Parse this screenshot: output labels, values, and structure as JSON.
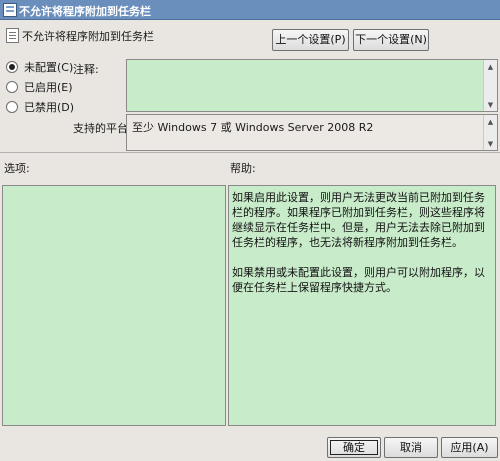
{
  "window": {
    "title": "不允许将程序附加到任务栏"
  },
  "header": {
    "policy_name": "不允许将程序附加到任务栏",
    "prev_button": "上一个设置(P)",
    "next_button": "下一个设置(N)"
  },
  "state": {
    "options": [
      {
        "label": "未配置(C)",
        "selected": true
      },
      {
        "label": "已启用(E)",
        "selected": false
      },
      {
        "label": "已禁用(D)",
        "selected": false
      }
    ]
  },
  "comment": {
    "label": "注释:",
    "value": ""
  },
  "platform": {
    "label": "支持的平台:",
    "value": "至少 Windows 7 或 Windows Server 2008 R2"
  },
  "options_section": {
    "label": "选项:"
  },
  "help_section": {
    "label": "帮助:",
    "paragraphs": [
      "如果启用此设置，则用户无法更改当前已附加到任务栏的程序。如果程序已附加到任务栏，则这些程序将继续显示在任务栏中。但是，用户无法去除已附加到任务栏的程序，也无法将新程序附加到任务栏。",
      "如果禁用或未配置此设置，则用户可以附加程序，以便在任务栏上保留程序快捷方式。"
    ]
  },
  "footer": {
    "ok_button": "确定",
    "cancel_button": "取消",
    "apply_button": "应用(A)"
  }
}
